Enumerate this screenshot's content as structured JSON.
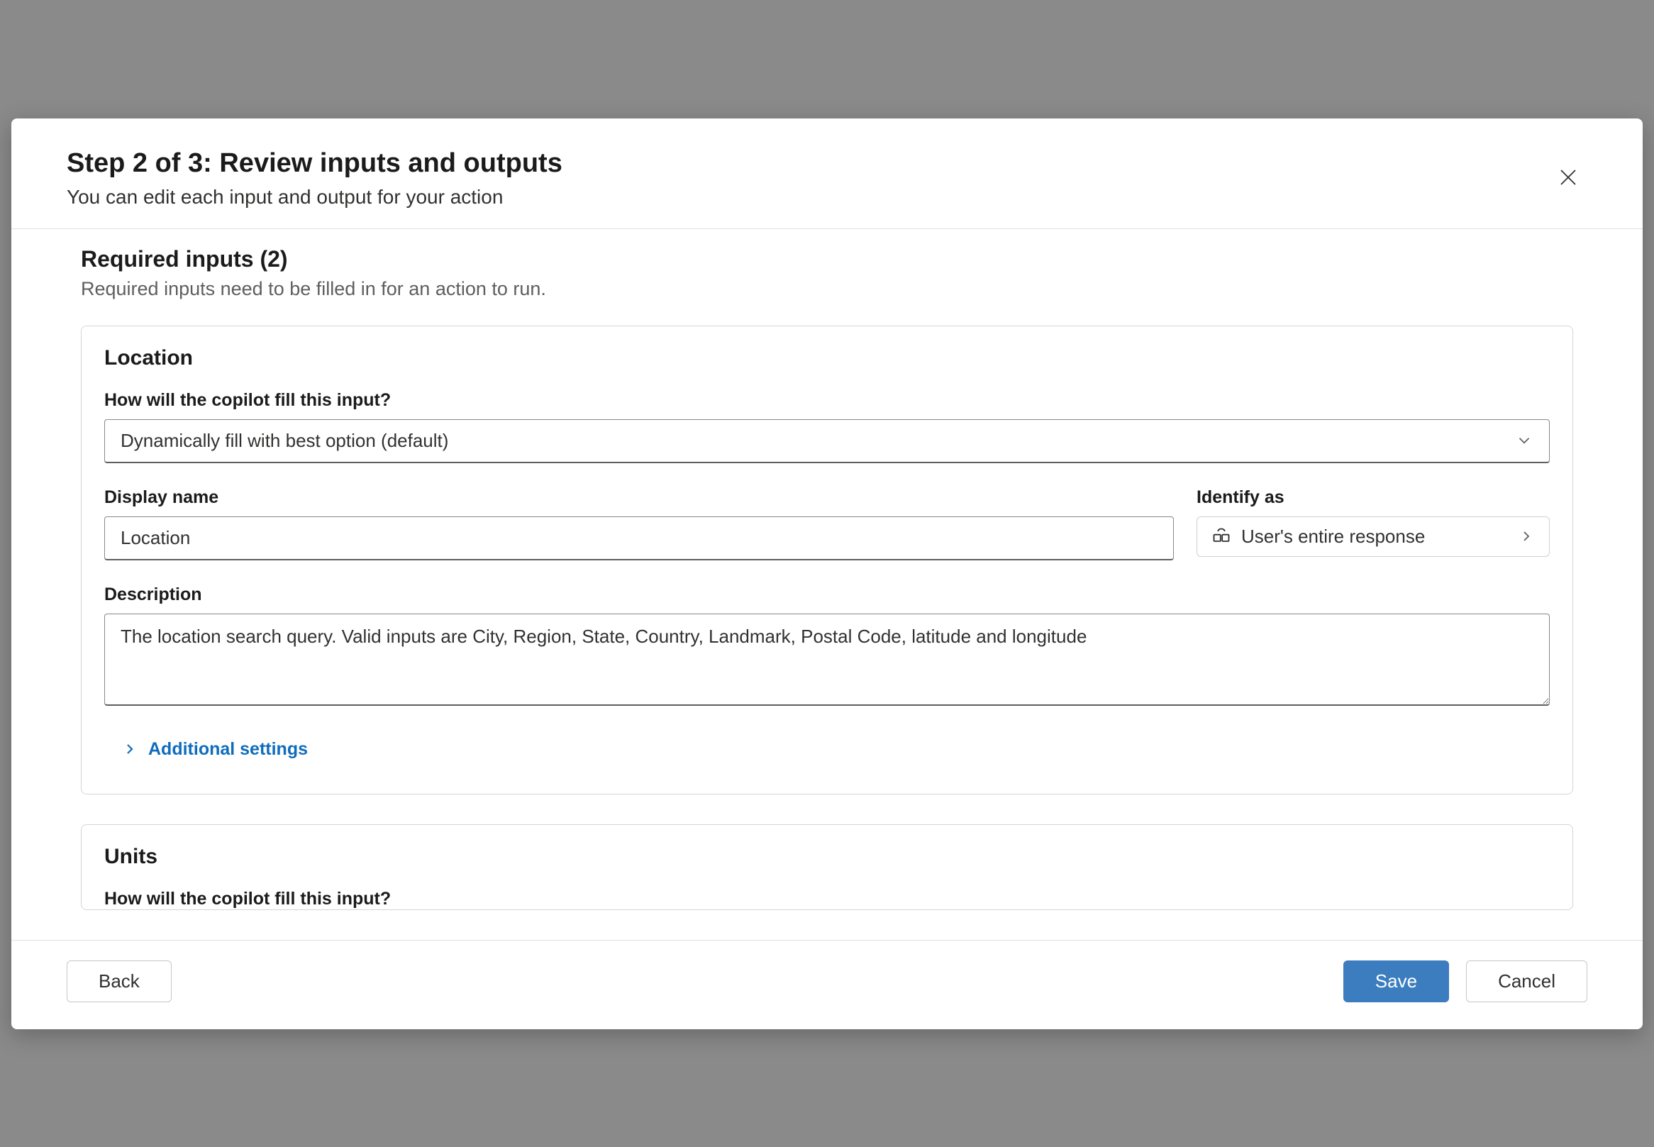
{
  "header": {
    "title": "Step 2 of 3: Review inputs and outputs",
    "subtitle": "You can edit each input and output for your action"
  },
  "section": {
    "heading": "Required inputs (2)",
    "subtext": "Required inputs need to be filled in for an action to run."
  },
  "cards": [
    {
      "title": "Location",
      "fill_label": "How will the copilot fill this input?",
      "fill_value": "Dynamically fill with best option (default)",
      "display_name_label": "Display name",
      "display_name_value": "Location",
      "identify_label": "Identify as",
      "identify_value": "User's entire response",
      "description_label": "Description",
      "description_value": "The location search query. Valid inputs are City, Region, State, Country, Landmark, Postal Code, latitude and longitude",
      "additional_settings": "Additional settings"
    },
    {
      "title": "Units",
      "fill_label_partial": "How will the copilot fill this input?"
    }
  ],
  "footer": {
    "back": "Back",
    "save": "Save",
    "cancel": "Cancel"
  }
}
